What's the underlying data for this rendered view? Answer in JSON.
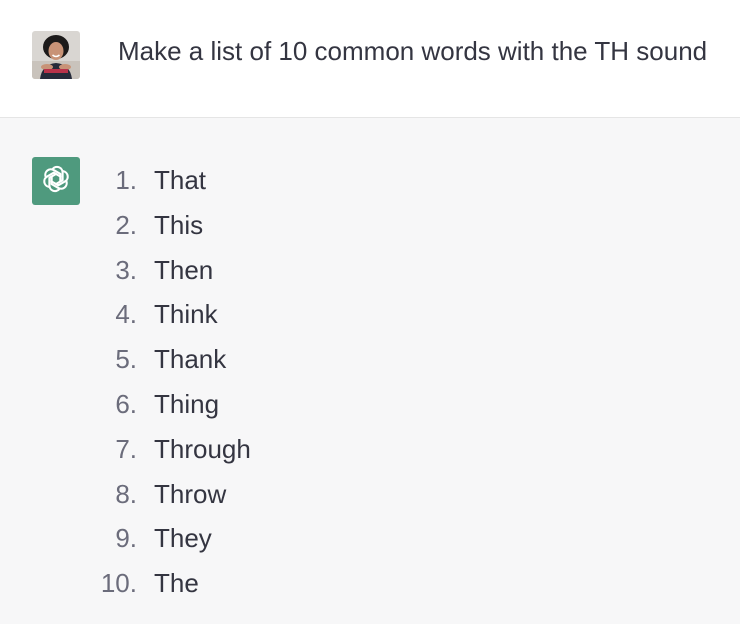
{
  "user_message": {
    "text": "Make a list of 10 common words with the TH sound"
  },
  "assistant_message": {
    "items": [
      {
        "num": "1.",
        "text": "That"
      },
      {
        "num": "2.",
        "text": "This"
      },
      {
        "num": "3.",
        "text": "Then"
      },
      {
        "num": "4.",
        "text": "Think"
      },
      {
        "num": "5.",
        "text": "Thank"
      },
      {
        "num": "6.",
        "text": "Thing"
      },
      {
        "num": "7.",
        "text": "Through"
      },
      {
        "num": "8.",
        "text": "Throw"
      },
      {
        "num": "9.",
        "text": "They"
      },
      {
        "num": "10.",
        "text": "The"
      }
    ]
  },
  "colors": {
    "assistant_avatar_bg": "#4f9a7e",
    "assistant_row_bg": "#f7f7f8",
    "text": "#343541",
    "number": "#6b6c7b"
  },
  "icons": {
    "user_avatar": "user-photo-avatar",
    "assistant_avatar": "openai-logo-icon"
  }
}
